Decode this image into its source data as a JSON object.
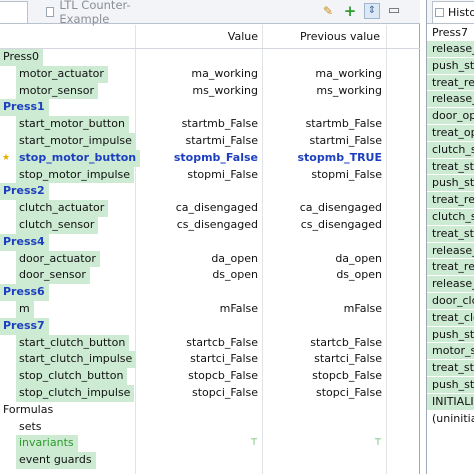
{
  "left_tabs": {
    "previous_tab_label": "",
    "active_tab_label": "LTL Counter-Example"
  },
  "toolbar": {
    "pin_icon": "pin-icon",
    "add_icon": "plus-icon",
    "filter_icon": "filter-icon",
    "minimize_icon": "minimize-icon"
  },
  "table": {
    "columns": {
      "name": "",
      "value": "Value",
      "previous": "Previous value"
    },
    "rows": [
      {
        "kind": "group",
        "style": "plain",
        "name": "Press0",
        "value": "",
        "previous": ""
      },
      {
        "kind": "child",
        "name": "motor_actuator",
        "value": "ma_working",
        "previous": "ma_working"
      },
      {
        "kind": "child",
        "name": "motor_sensor",
        "value": "ms_working",
        "previous": "ms_working"
      },
      {
        "kind": "group",
        "name": "Press1",
        "value": "",
        "previous": ""
      },
      {
        "kind": "child",
        "name": "start_motor_button",
        "value": "startmb_False",
        "previous": "startmb_False"
      },
      {
        "kind": "child",
        "name": "start_motor_impulse",
        "value": "startmi_False",
        "previous": "startmi_False"
      },
      {
        "kind": "child",
        "highlight": true,
        "star": true,
        "name": "stop_motor_button",
        "value": "stopmb_False",
        "previous": "stopmb_TRUE"
      },
      {
        "kind": "child",
        "name": "stop_motor_impulse",
        "value": "stopmi_False",
        "previous": "stopmi_False"
      },
      {
        "kind": "group",
        "name": "Press2",
        "value": "",
        "previous": ""
      },
      {
        "kind": "child",
        "name": "clutch_actuator",
        "value": "ca_disengaged",
        "previous": "ca_disengaged"
      },
      {
        "kind": "child",
        "name": "clutch_sensor",
        "value": "cs_disengaged",
        "previous": "cs_disengaged"
      },
      {
        "kind": "group",
        "name": "Press4",
        "value": "",
        "previous": ""
      },
      {
        "kind": "child",
        "name": "door_actuator",
        "value": "da_open",
        "previous": "da_open"
      },
      {
        "kind": "child",
        "name": "door_sensor",
        "value": "ds_open",
        "previous": "ds_open"
      },
      {
        "kind": "group",
        "name": "Press6",
        "value": "",
        "previous": ""
      },
      {
        "kind": "child",
        "name": "m",
        "value": "mFalse",
        "previous": "mFalse"
      },
      {
        "kind": "group",
        "name": "Press7",
        "value": "",
        "previous": ""
      },
      {
        "kind": "child",
        "name": "start_clutch_button",
        "value": "startcb_False",
        "previous": "startcb_False"
      },
      {
        "kind": "child",
        "name": "start_clutch_impulse",
        "value": "startci_False",
        "previous": "startci_False"
      },
      {
        "kind": "child",
        "name": "stop_clutch_button",
        "value": "stopcb_False",
        "previous": "stopcb_False"
      },
      {
        "kind": "child",
        "name": "stop_clutch_impulse",
        "value": "stopci_False",
        "previous": "stopci_False"
      },
      {
        "kind": "group",
        "style": "plain",
        "noname": true,
        "name": "Formulas",
        "value": "",
        "previous": ""
      },
      {
        "kind": "child",
        "noname": true,
        "name": "sets",
        "value": "",
        "previous": ""
      },
      {
        "kind": "child",
        "green": true,
        "name": "invariants",
        "value": "⊤",
        "previous": "⊤"
      },
      {
        "kind": "child",
        "name": "event guards",
        "value": "",
        "previous": ""
      }
    ]
  },
  "history_view": {
    "tab_label": "Histor",
    "column_header": "Press7",
    "items": [
      {
        "label": "release_s"
      },
      {
        "label": "push_stc"
      },
      {
        "label": "treat_rele"
      },
      {
        "label": "release_s"
      },
      {
        "label": "door_op"
      },
      {
        "label": "treat_op"
      },
      {
        "label": "clutch_st"
      },
      {
        "label": "treat_sto"
      },
      {
        "label": "push_stc"
      },
      {
        "label": "treat_rele"
      },
      {
        "label": "clutch_st"
      },
      {
        "label": "treat_sta"
      },
      {
        "label": "release_s"
      },
      {
        "label": "treat_rele"
      },
      {
        "label": "release_s"
      },
      {
        "label": "door_clc"
      },
      {
        "label": "treat_clo"
      },
      {
        "label": "push_sta"
      },
      {
        "label": "motor_st"
      },
      {
        "label": "treat_sta"
      },
      {
        "label": "push_sta"
      },
      {
        "label": "INITIALIS"
      },
      {
        "label": "(uninitial",
        "plain": true
      }
    ]
  },
  "colors": {
    "row_highlight": "#cdebd3",
    "group_label": "#1c3fbf",
    "invariant": "#2b9a2b"
  }
}
